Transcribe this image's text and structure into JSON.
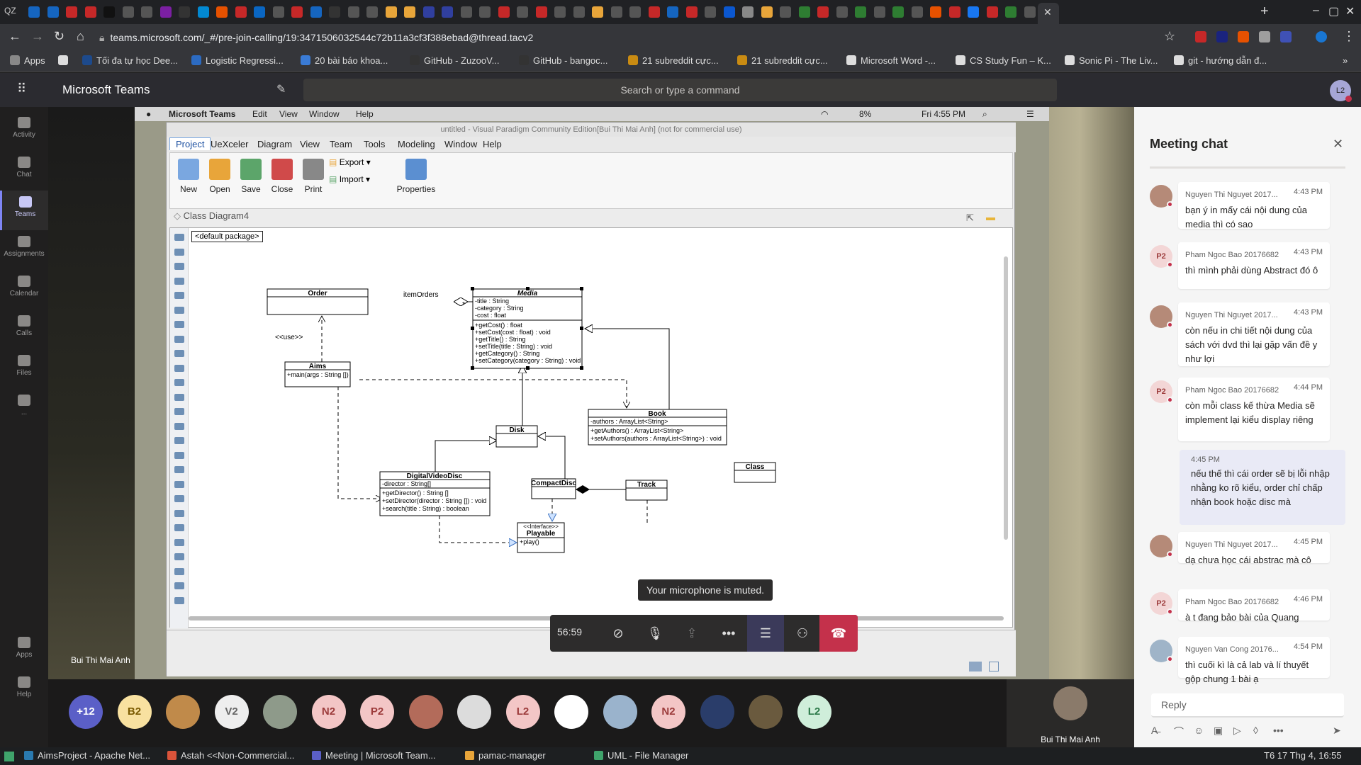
{
  "browser": {
    "url": "teams.microsoft.com/_#/pre-join-calling/19:3471506032544c72b11a3cf3f388ebad@thread.tacv2",
    "tab_strip_left": "QZ"
  },
  "bookmarks": [
    {
      "label": "Apps",
      "color": "#888"
    },
    {
      "label": "",
      "color": "#ddd"
    },
    {
      "label": "Tối đa tự học Dee...",
      "color": "#1d4a8c"
    },
    {
      "label": "Logistic Regressi...",
      "color": "#2c6bc2"
    },
    {
      "label": "20 bài báo khoa...",
      "color": "#3a7bd5"
    },
    {
      "label": "GitHub - ZuzooV...",
      "color": "#333"
    },
    {
      "label": "GitHub - bangoc...",
      "color": "#333"
    },
    {
      "label": "21 subreddit cực...",
      "color": "#c98b12"
    },
    {
      "label": "21 subreddit cực...",
      "color": "#c98b12"
    },
    {
      "label": "Microsoft Word -...",
      "color": "#ddd"
    },
    {
      "label": "CS Study Fun – K...",
      "color": "#ddd"
    },
    {
      "label": "Sonic Pi - The Liv...",
      "color": "#ddd"
    },
    {
      "label": "git - hướng dẫn đ...",
      "color": "#ddd"
    }
  ],
  "teams": {
    "app_title": "Microsoft Teams",
    "search_placeholder": "Search or type a command",
    "me_initials": "L2",
    "rail": [
      {
        "label": "Activity",
        "active": false
      },
      {
        "label": "Chat",
        "active": false
      },
      {
        "label": "Teams",
        "active": true
      },
      {
        "label": "Assignments",
        "active": false
      },
      {
        "label": "Calendar",
        "active": false
      },
      {
        "label": "Calls",
        "active": false
      },
      {
        "label": "Files",
        "active": false
      },
      {
        "label": "...",
        "active": false
      }
    ],
    "rail_bottom": [
      {
        "label": "Apps"
      },
      {
        "label": "Help"
      }
    ]
  },
  "mac": {
    "app": "Microsoft Teams",
    "menu": [
      "Edit",
      "View",
      "Window",
      "Help"
    ],
    "battery": "8%",
    "clock": "Fri 4:55 PM"
  },
  "vp": {
    "title": "untitled - Visual Paradigm Community Edition[Bui Thi Mai Anh] (not for commercial use)",
    "tabs": [
      "Project",
      "UeXceler",
      "Diagram",
      "View",
      "Team",
      "Tools",
      "Modeling",
      "Window",
      "Help"
    ],
    "ribbon": [
      {
        "label": "New",
        "color": "#7aa7e0"
      },
      {
        "label": "Open",
        "color": "#e8a53a"
      },
      {
        "label": "Save",
        "color": "#5ca56a"
      },
      {
        "label": "Close",
        "color": "#d04a4a"
      },
      {
        "label": "Print",
        "color": "#888"
      }
    ],
    "ribbon_menu": [
      "Export",
      "Import"
    ],
    "properties": "Properties",
    "diagram_tab": "Class Diagram4",
    "package": "<default package>"
  },
  "uml": {
    "order": {
      "name": "Order"
    },
    "media": {
      "name": "Media",
      "attrs": [
        "-title : String",
        "-category : String",
        "-cost : float"
      ],
      "ops": [
        "+getCost() : float",
        "+setCost(cost : float) : void",
        "+getTitle() : String",
        "+setTitle(title : String) : void",
        "+getCategory() : String",
        "+setCategory(category : String) : void"
      ]
    },
    "aims": {
      "name": "Aims",
      "ops": [
        "+main(args : String [])"
      ]
    },
    "book": {
      "name": "Book",
      "attrs": [
        "-authors : ArrayList<String>"
      ],
      "ops": [
        "+getAuthors() : ArrayList<String>",
        "+setAuthors(authors : ArrayList<String>) : void"
      ]
    },
    "disk": {
      "name": "Disk"
    },
    "dvd": {
      "name": "DigitalVideoDisc",
      "attrs": [
        "-director : String[]"
      ],
      "ops": [
        "+getDirector() : String []",
        "+setDirector(director : String []) : void",
        "+search(title : String) : boolean"
      ]
    },
    "cd": {
      "name": "CompactDisc"
    },
    "track": {
      "name": "Track"
    },
    "playable": {
      "stereotype": "<<Interface>>",
      "name": "Playable",
      "ops": [
        "+play()"
      ]
    },
    "class": {
      "name": "Class"
    },
    "labels": {
      "item_orders": "itemOrders",
      "use": "<<use>>",
      "multiplicity": "*"
    }
  },
  "call": {
    "timer": "56:59",
    "tooltip": "Your microphone is muted.",
    "presenter": "Bui Thi Mai Anh"
  },
  "participants": [
    {
      "initials": "+12",
      "bg": "#5b5fc7",
      "fg": "#ffffff"
    },
    {
      "initials": "B2",
      "bg": "#f8e1a0",
      "fg": "#7a5a00"
    },
    {
      "initials": "",
      "bg": "#c08a4a",
      "fg": "#ffffff"
    },
    {
      "initials": "V2",
      "bg": "#eeeeee",
      "fg": "#666666"
    },
    {
      "initials": "",
      "bg": "#8e9a8a",
      "fg": "#ffffff"
    },
    {
      "initials": "N2",
      "bg": "#f3c6c6",
      "fg": "#9c3b3b"
    },
    {
      "initials": "P2",
      "bg": "#f3c6c6",
      "fg": "#9c3b3b"
    },
    {
      "initials": "",
      "bg": "#b36b5a",
      "fg": "#ffffff"
    },
    {
      "initials": "",
      "bg": "#dcdcdc",
      "fg": "#666666"
    },
    {
      "initials": "L2",
      "bg": "#f3c6c6",
      "fg": "#9c3b3b"
    },
    {
      "initials": "",
      "bg": "#ffffff",
      "fg": "#666666"
    },
    {
      "initials": "",
      "bg": "#9ab3cc",
      "fg": "#ffffff"
    },
    {
      "initials": "N2",
      "bg": "#f3c6c6",
      "fg": "#9c3b3b"
    },
    {
      "initials": "",
      "bg": "#2a3d6a",
      "fg": "#ffffff"
    },
    {
      "initials": "",
      "bg": "#6a5a3e",
      "fg": "#ffffff"
    },
    {
      "initials": "L2",
      "bg": "#cfeeda",
      "fg": "#2d7a4a"
    }
  ],
  "self_tile": {
    "name": "Bui Thi Mai Anh"
  },
  "chat": {
    "title": "Meeting chat",
    "messages": [
      {
        "author": "Nguyen Thi Nguyet 2017...",
        "time": "4:43 PM",
        "text": "bạn ý in mấy cái nội dung của media thì có sao",
        "avatar": "",
        "avbg": "#b58a78"
      },
      {
        "author": "Pham Ngoc Bao 20176682",
        "time": "4:43 PM",
        "text": "thì mình phải dùng Abstract đó ô",
        "avatar": "P2",
        "avbg": "#f3d6d6"
      },
      {
        "author": "Nguyen Thi Nguyet 2017...",
        "time": "4:43 PM",
        "text": "còn nếu in chi tiết nội dung của sách với dvd thì lại gặp vấn đề y như lợi",
        "avatar": "",
        "avbg": "#b58a78"
      },
      {
        "author": "Pham Ngoc Bao 20176682",
        "time": "4:44 PM",
        "text": "còn mỗi class kế thừa Media sẽ implement lại kiểu display riêng",
        "avatar": "P2",
        "avbg": "#f3d6d6"
      },
      {
        "author": "Nguyen Thi Nguyet 2017...",
        "time": "4:45 PM",
        "text": "dạ chưa học cái abstrac mà cô",
        "avatar": "",
        "avbg": "#b58a78"
      },
      {
        "author": "Pham Ngoc Bao 20176682",
        "time": "4:46 PM",
        "text": "à t đang bảo bài của Quang",
        "avatar": "P2",
        "avbg": "#f3d6d6"
      },
      {
        "author": "Nguyen Van Cong 20176...",
        "time": "4:54 PM",
        "text": "thì cuối kì là cả lab và lí thuyết gộp chung 1 bài ạ",
        "avatar": "",
        "avbg": "#9fb4c8"
      }
    ],
    "my_message": {
      "time": "4:45 PM",
      "text": "nếu thế thì cái order sẽ bị lỗi nhập nhằng ko rõ kiểu, order chỉ chấp nhận book hoặc disc mà"
    },
    "reply_placeholder": "Reply"
  },
  "taskbar": {
    "items": [
      {
        "label": "AimsProject - Apache Net...",
        "color": "#2a7ab0"
      },
      {
        "label": "Astah <<Non-Commercial...",
        "color": "#d9533a"
      },
      {
        "label": "Meeting | Microsoft Team...",
        "color": "#5b5fc7"
      },
      {
        "label": "pamac-manager",
        "color": "#e8a53a"
      },
      {
        "label": "UML - File Manager",
        "color": "#3fa36b"
      }
    ],
    "clock": "T6 17 Thg 4, 16:55"
  }
}
